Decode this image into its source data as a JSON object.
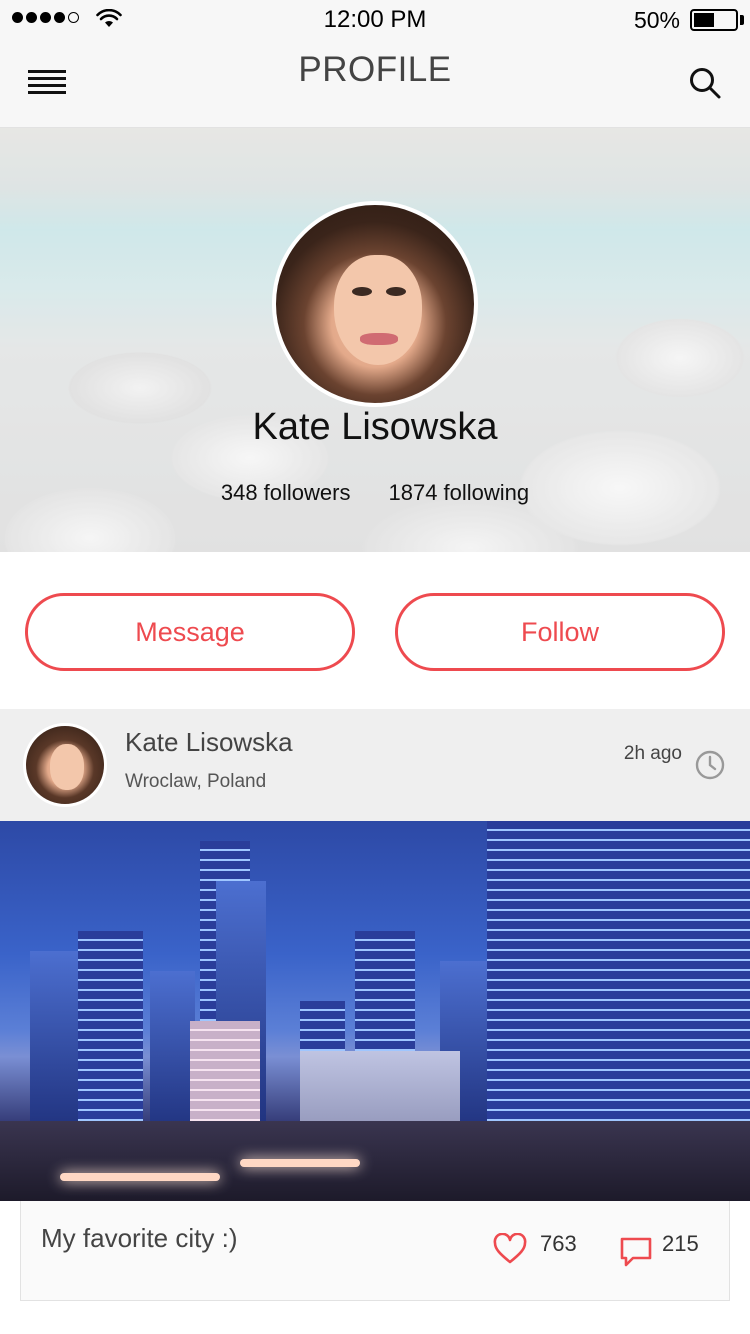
{
  "status_bar": {
    "time": "12:00 PM",
    "battery": "50%",
    "battery_level": 0.5,
    "signal_bars": 4,
    "signal_total": 5
  },
  "nav": {
    "title": "PROFILE",
    "menu_icon": "hamburger-menu-icon",
    "search_icon": "search-icon"
  },
  "profile": {
    "name": "Kate Lisowska",
    "followers": "348 followers",
    "following": "1874 following"
  },
  "actions": {
    "message_label": "Message",
    "follow_label": "Follow",
    "accent_color": "#ee4a4f"
  },
  "post": {
    "author": "Kate Lisowska",
    "location": "Wroclaw, Poland",
    "time": "2h ago",
    "caption": "My favorite city :)",
    "likes": "763",
    "comments": "215"
  }
}
